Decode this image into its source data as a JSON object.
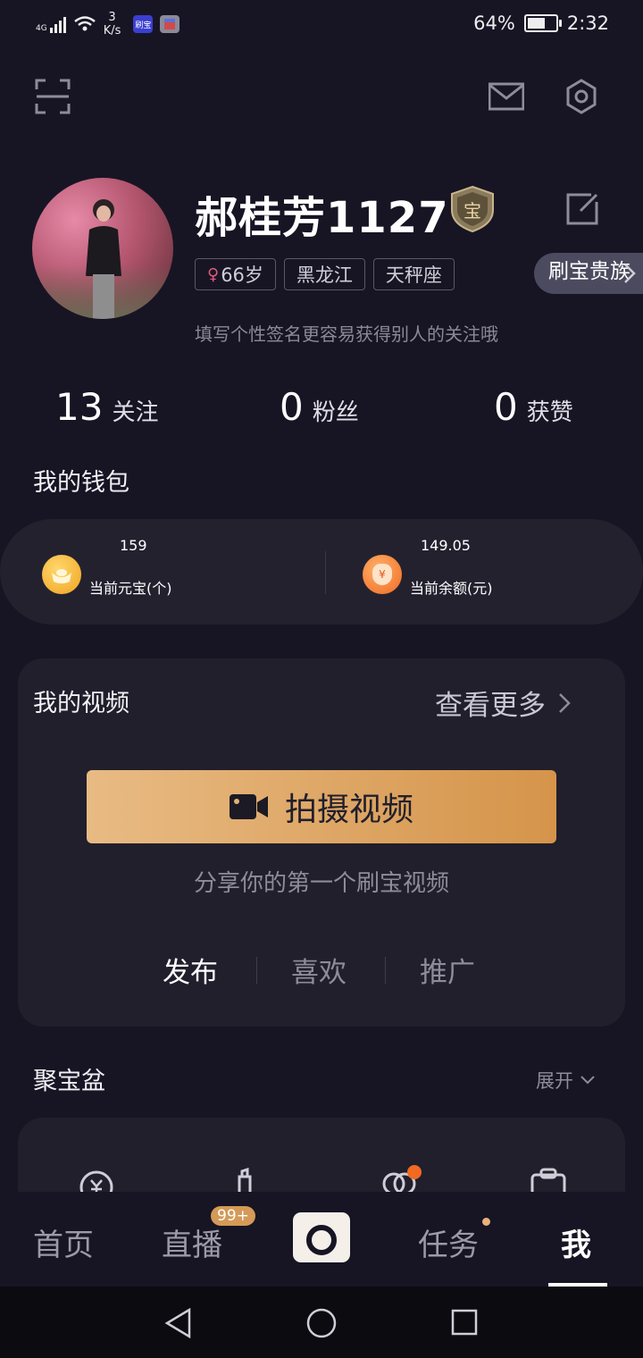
{
  "status_bar": {
    "network": "4G",
    "speed_value": "3",
    "speed_unit": "K/s",
    "app_badge_1": "刷宝",
    "battery_percent": "64%",
    "battery_level": 0.64,
    "time": "2:32"
  },
  "top_bar": {
    "icons": [
      "scan-icon",
      "mail-icon",
      "settings-icon"
    ]
  },
  "profile": {
    "username": "郝桂芳1127",
    "tags": {
      "sex_symbol": "♀",
      "age": "66岁",
      "region": "黑龙江",
      "zodiac": "天秤座"
    },
    "vip_label": "刷宝贵族",
    "bio_placeholder": "填写个性签名更容易获得别人的关注哦",
    "badge_char": "宝"
  },
  "stats": [
    {
      "value": "13",
      "label": "关注"
    },
    {
      "value": "0",
      "label": "粉丝"
    },
    {
      "value": "0",
      "label": "获赞"
    }
  ],
  "wallet": {
    "title": "我的钱包",
    "ingot": {
      "value": "159",
      "label": "当前元宝(个)"
    },
    "balance": {
      "value": "149.05",
      "label": "当前余额(元)",
      "icon_char": "¥"
    }
  },
  "videos": {
    "title": "我的视频",
    "more_label": "查看更多",
    "shoot_button": "拍摄视频",
    "tip": "分享你的第一个刷宝视频",
    "tabs": [
      "发布",
      "喜欢",
      "推广"
    ],
    "active_tab": 0
  },
  "treasure": {
    "title": "聚宝盆",
    "expand_label": "展开"
  },
  "bottom_nav": {
    "items": [
      "首页",
      "直播",
      "任务",
      "我"
    ],
    "live_badge": "99+",
    "active": "我"
  },
  "colors": {
    "background": "#171524",
    "card": "#211f2c",
    "accent": "#d49a57",
    "muted": "#8e8b9b"
  }
}
